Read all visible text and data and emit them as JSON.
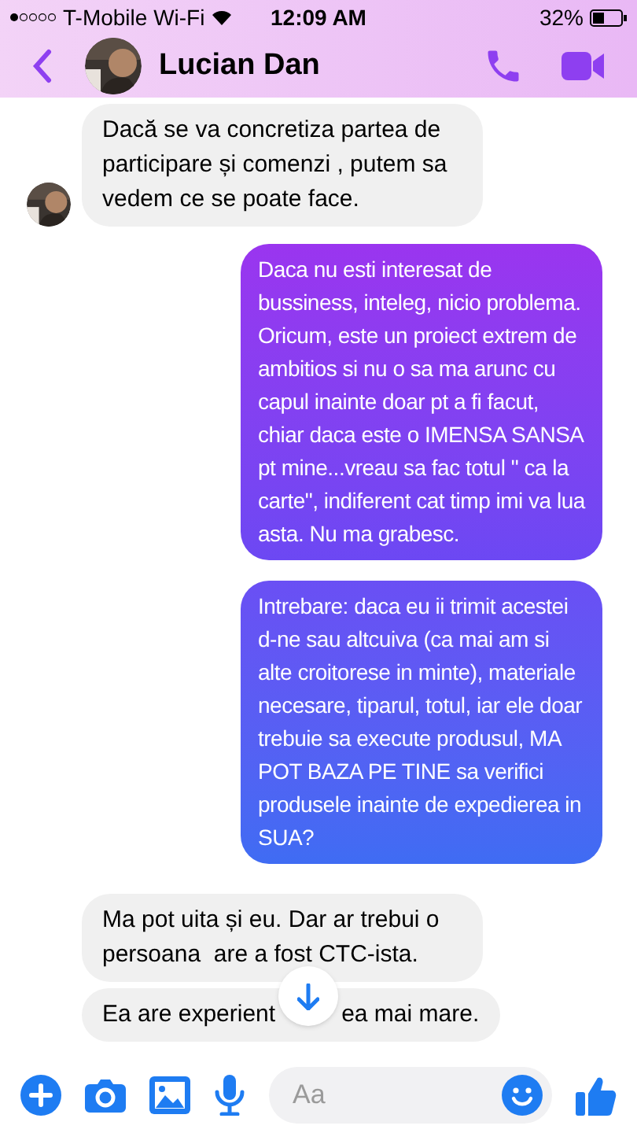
{
  "status_bar": {
    "carrier": "T-Mobile Wi-Fi",
    "time": "12:09 AM",
    "battery": "32%"
  },
  "header": {
    "title": "Lucian Dan"
  },
  "messages": [
    {
      "kind": "received",
      "avatar": true,
      "segments": [
        "Dacă se va concretiza partea de participare și comenzi , putem sa vedem ce se poate face."
      ]
    },
    {
      "kind": "sent",
      "segments": [
        "Daca nu esti interesat de bussiness, inteleg, nicio problema. Oricum, este un proiect extrem de ambitios si nu o sa ma arunc cu capul inainte doar pt a fi facut, chiar daca este o IMENSA SANSA pt mine...vreau sa fac totul \" ca la carte\", indiferent cat timp imi va lua asta. Nu ma grabesc."
      ]
    },
    {
      "kind": "sent",
      "segments": [
        "Intrebare: daca eu ii trimit acestei d-ne sau altcuiva (ca mai am si alte croitorese in minte), materiale necesare, tiparul, totul, iar ele doar trebuie sa execute produsul, MA POT BAZA PE TINE sa verifici produsele inainte de expedierea in SUA?"
      ]
    },
    {
      "kind": "received",
      "avatar": false,
      "segments": [
        "Ma pot uita și eu. Dar ar trebui o persoana  are a fost CTC-ista."
      ]
    },
    {
      "kind": "received",
      "avatar": false,
      "segments": [
        "Ea are experient",
        "ea mai mare."
      ]
    }
  ],
  "composer": {
    "placeholder": "Aa"
  }
}
